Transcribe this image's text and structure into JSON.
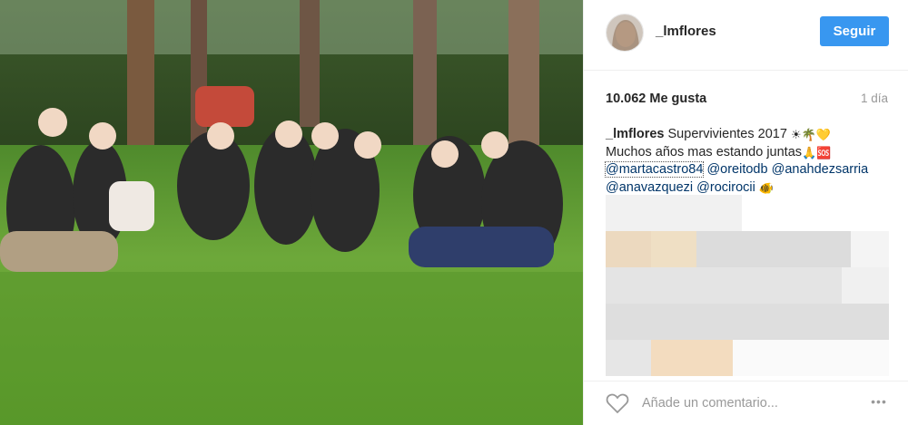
{
  "post": {
    "photo_alt": "",
    "header": {
      "username": "_lmflores",
      "follow_label": "Seguir"
    },
    "stats": {
      "likes": "10.062 Me gusta",
      "timestamp": "1 día"
    },
    "caption": {
      "user": "_lmflores",
      "line1_text": "Supervivientes 2017",
      "line1_emojis": [
        "☀",
        "🌴",
        "💛"
      ],
      "line2_text": "Muchos años mas estando juntas",
      "line2_emojis": [
        "🙏",
        "🆘"
      ],
      "mentions": [
        "@martacastro84",
        "@oreitodb",
        "@anahdezsarria",
        "@anavazquezi",
        "@rocirocii"
      ],
      "trailing_emoji": "🐠"
    },
    "comment": {
      "placeholder": "Añade un comentario...",
      "more_label": "•••"
    },
    "colors": {
      "follow_button": "#3897f0",
      "mention": "#003569",
      "muted": "#999999"
    }
  }
}
